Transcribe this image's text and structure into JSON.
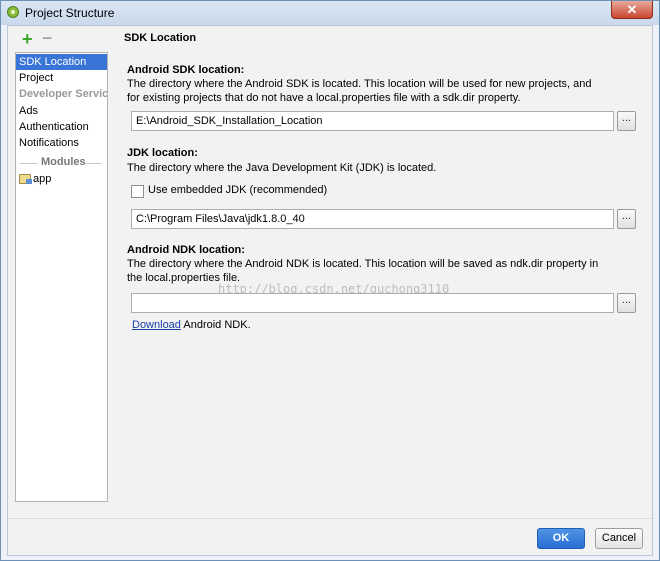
{
  "window": {
    "title": "Project Structure",
    "close_glyph": "✕"
  },
  "toolbar": {
    "add_glyph": "+",
    "remove_glyph": "−"
  },
  "sidebar": {
    "items": [
      {
        "label": "SDK Location",
        "selected": true
      },
      {
        "label": "Project"
      }
    ],
    "group_header": "Developer Servic...",
    "service_items": [
      "Ads",
      "Authentication",
      "Notifications"
    ],
    "modules_header": "Modules",
    "modules": [
      "app"
    ]
  },
  "main": {
    "title": "SDK Location",
    "sdk": {
      "label": "Android SDK location:",
      "description": "The directory where the Android SDK is located. This location will be used for new projects, and for existing projects that do not have a local.properties file with a sdk.dir property.",
      "value": "E:\\Android_SDK_Installation_Location",
      "browse": "..."
    },
    "jdk": {
      "label": "JDK location:",
      "description": "The directory where the Java Development Kit (JDK) is located.",
      "checkbox_label": "Use embedded JDK (recommended)",
      "value": "C:\\Program Files\\Java\\jdk1.8.0_40",
      "browse": "..."
    },
    "ndk": {
      "label": "Android NDK location:",
      "description": "The directory where the Android NDK is located. This location will be saved as ndk.dir property in the local.properties file.",
      "value": "",
      "browse": "...",
      "download_link": "Download",
      "download_suffix": " Android NDK."
    },
    "watermark": "http://blog.csdn.net/guchong3110"
  },
  "buttons": {
    "ok": "OK",
    "cancel": "Cancel"
  }
}
